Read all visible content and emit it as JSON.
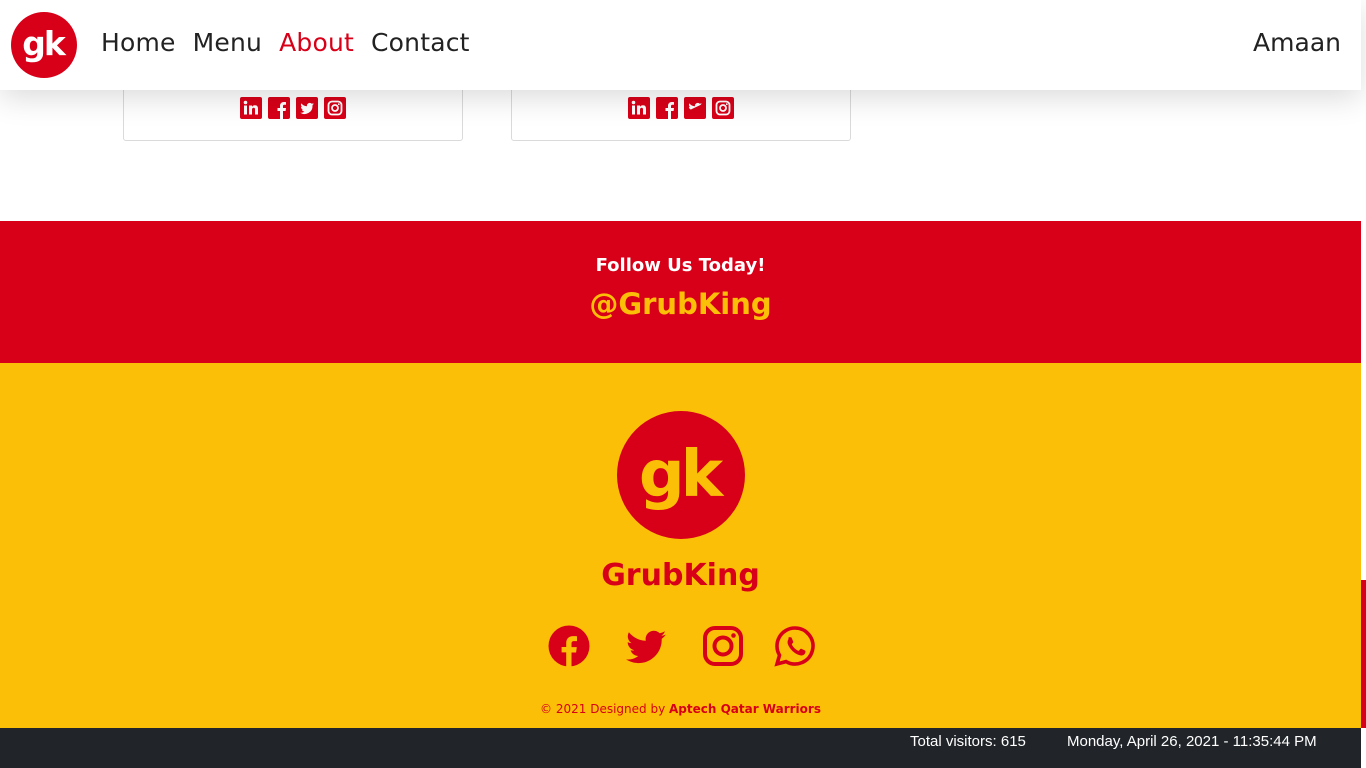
{
  "navbar": {
    "logo_text": "gk",
    "links": [
      {
        "label": "Home",
        "active": false
      },
      {
        "label": "Menu",
        "active": false
      },
      {
        "label": "About",
        "active": true
      },
      {
        "label": "Contact",
        "active": false
      }
    ],
    "user_name": "Amaan"
  },
  "team_cards": [
    {
      "social_icons": [
        "linkedin-icon",
        "facebook-icon",
        "twitter-icon",
        "instagram-icon"
      ]
    },
    {
      "social_icons": [
        "linkedin-icon",
        "facebook-icon",
        "twitter-icon",
        "instagram-icon"
      ]
    }
  ],
  "follow": {
    "title": "Follow Us Today!",
    "handle": "@GrubKing"
  },
  "footer": {
    "logo_text": "gk",
    "brand": "GrubKing",
    "social_icons": [
      "facebook-icon",
      "twitter-icon",
      "instagram-icon",
      "whatsapp-icon"
    ],
    "copyright_prefix": "© 2021 Designed by ",
    "copyright_author": "Aptech Qatar Warriors"
  },
  "status": {
    "visitors": "Total visitors: 615",
    "datetime": "Monday, April 26, 2021 - 11:35:44 PM"
  },
  "colors": {
    "brand_red": "#d80018",
    "brand_yellow": "#fcbf08",
    "status_bar": "#212529"
  }
}
